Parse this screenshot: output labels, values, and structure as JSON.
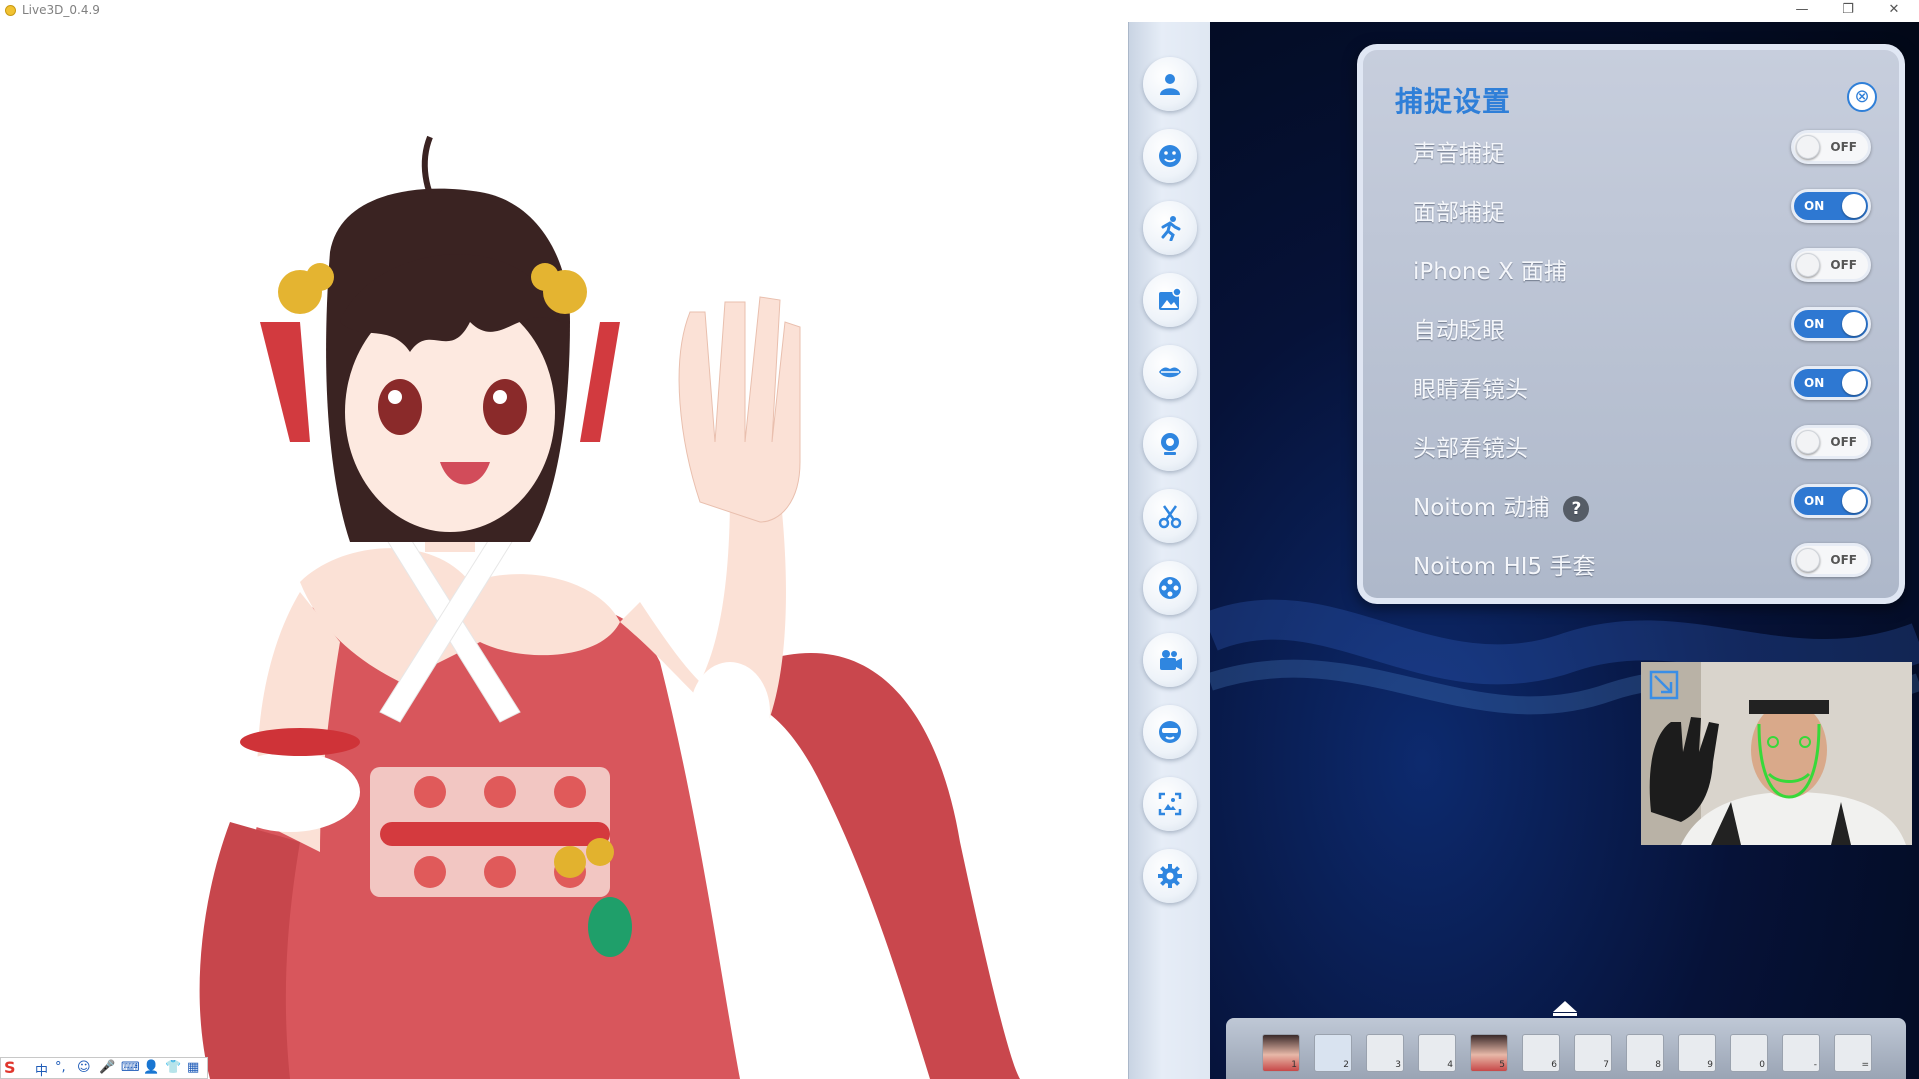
{
  "window": {
    "title": "Live3D_0.4.9",
    "minimize": "—",
    "restore": "❐",
    "close": "✕"
  },
  "rail": {
    "items": [
      {
        "name": "character-icon"
      },
      {
        "name": "expression-icon"
      },
      {
        "name": "motion-icon"
      },
      {
        "name": "background-icon"
      },
      {
        "name": "lips-icon"
      },
      {
        "name": "webcam-icon"
      },
      {
        "name": "scissors-icon"
      },
      {
        "name": "film-reel-icon"
      },
      {
        "name": "video-camera-icon"
      },
      {
        "name": "face-mask-icon"
      },
      {
        "name": "screenshot-icon"
      },
      {
        "name": "settings-icon"
      }
    ]
  },
  "panel": {
    "title": "捕捉设置",
    "close_icon": "⊗",
    "rows": [
      {
        "label": "声音捕捉",
        "state": "OFF"
      },
      {
        "label": "面部捕捉",
        "state": "ON"
      },
      {
        "label": "iPhone X 面捕",
        "state": "OFF"
      },
      {
        "label": "自动眨眼",
        "state": "ON"
      },
      {
        "label": "眼睛看镜头",
        "state": "ON"
      },
      {
        "label": "头部看镜头",
        "state": "OFF"
      },
      {
        "label": "Noitom 动捕",
        "state": "ON",
        "help": "?"
      },
      {
        "label": "Noitom HI5 手套",
        "state": "OFF"
      }
    ]
  },
  "bottom_bar": {
    "slots": [
      {
        "num": "1",
        "type": "avatar"
      },
      {
        "num": "2",
        "type": "scene"
      },
      {
        "num": "3",
        "type": "empty"
      },
      {
        "num": "4",
        "type": "empty"
      },
      {
        "num": "5",
        "type": "avatar"
      },
      {
        "num": "6",
        "type": "empty"
      },
      {
        "num": "7",
        "type": "empty"
      },
      {
        "num": "8",
        "type": "empty"
      },
      {
        "num": "9",
        "type": "empty"
      },
      {
        "num": "0",
        "type": "empty"
      },
      {
        "num": "-",
        "type": "empty"
      },
      {
        "num": "=",
        "type": "empty"
      }
    ]
  },
  "ime": {
    "logo": "S",
    "lang": "中",
    "punct": "°,",
    "emoji": "☺",
    "mic": "🎤",
    "keyboard": "⌨",
    "user": "👤",
    "skin": "👕",
    "apps": "▦"
  },
  "colors": {
    "accent": "#2f7fd8",
    "toggle_on": "#2e78d2",
    "panel_bg": "#b6bfd0",
    "background_dark": "#061238"
  }
}
